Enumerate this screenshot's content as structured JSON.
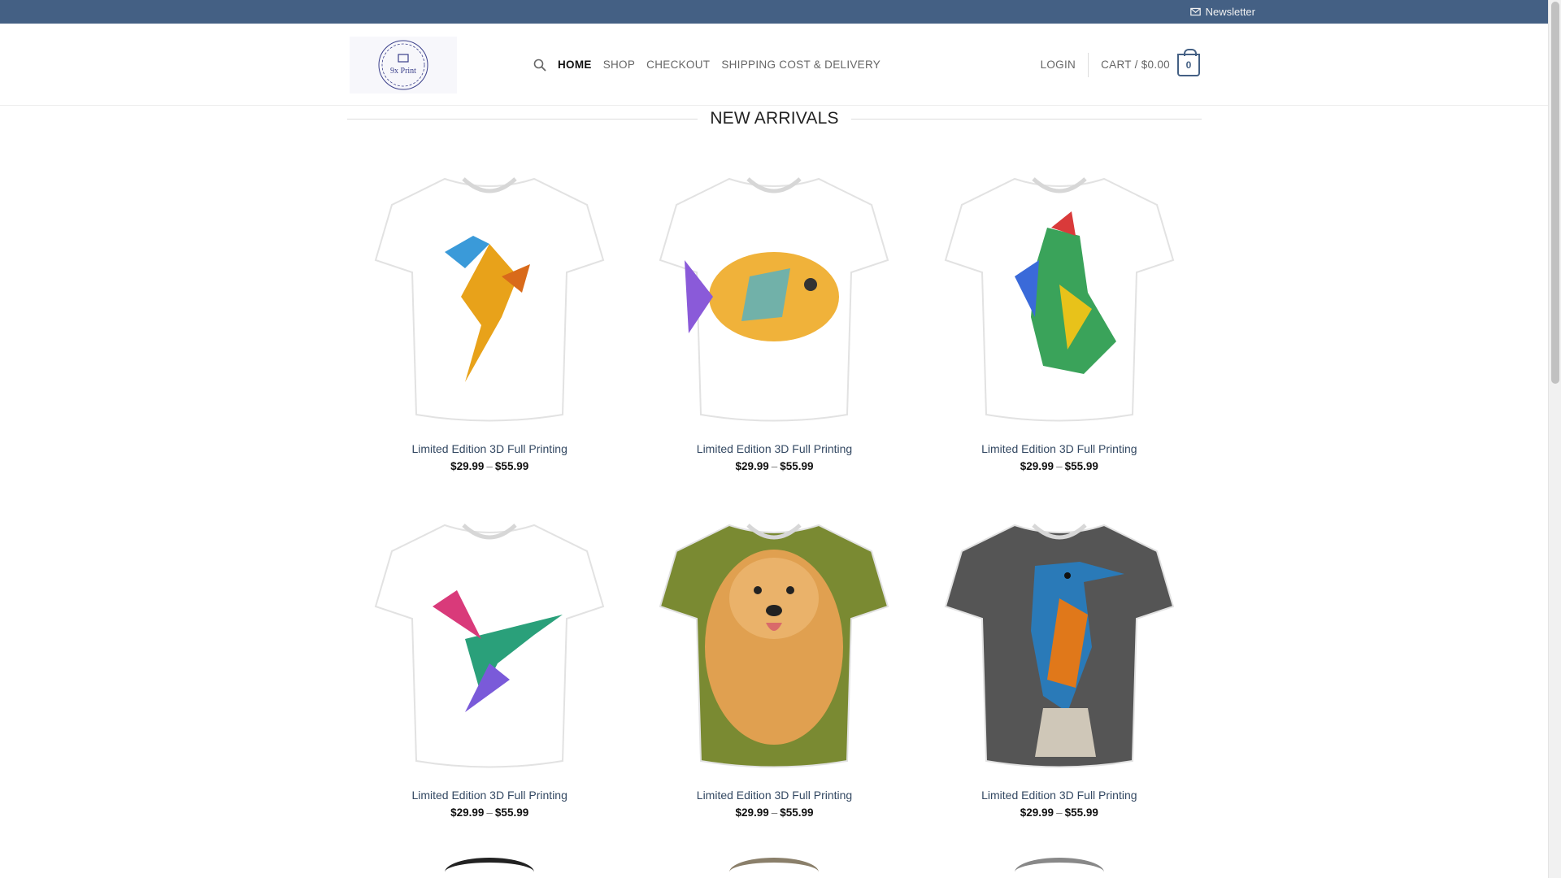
{
  "topbar": {
    "newsletter_label": "Newsletter"
  },
  "header": {
    "logo_text": "9x Print",
    "nav": [
      "HOME",
      "SHOP",
      "CHECKOUT",
      "SHIPPING COST & DELIVERY"
    ],
    "login_label": "LOGIN",
    "cart_label": "CART / $0.00",
    "cart_count": "0"
  },
  "section": {
    "title": "NEW ARRIVALS"
  },
  "products": [
    {
      "title": "Limited Edition 3D Full Printing",
      "price_min": "$29.99",
      "price_sep": "–",
      "price_max": "$55.99",
      "shirt_color": "#ffffff",
      "art": "parrot"
    },
    {
      "title": "Limited Edition 3D Full Printing",
      "price_min": "$29.99",
      "price_sep": "–",
      "price_max": "$55.99",
      "shirt_color": "#ffffff",
      "art": "fish"
    },
    {
      "title": "Limited Edition 3D Full Printing",
      "price_min": "$29.99",
      "price_sep": "–",
      "price_max": "$55.99",
      "shirt_color": "#ffffff",
      "art": "rooster"
    },
    {
      "title": "Limited Edition 3D Full Printing",
      "price_min": "$29.99",
      "price_sep": "–",
      "price_max": "$55.99",
      "shirt_color": "#ffffff",
      "art": "hummingbird"
    },
    {
      "title": "Limited Edition 3D Full Printing",
      "price_min": "$29.99",
      "price_sep": "–",
      "price_max": "$55.99",
      "shirt_color": "#7a8a32",
      "art": "golden-retriever"
    },
    {
      "title": "Limited Edition 3D Full Printing",
      "price_min": "$29.99",
      "price_sep": "–",
      "price_max": "$55.99",
      "shirt_color": "#555555",
      "art": "kingfisher"
    }
  ],
  "peek_colors": [
    "#222222",
    "#8a7f6a",
    "#888888"
  ],
  "colors": {
    "topbar": "#446084",
    "accent": "#446084",
    "link": "#334862"
  }
}
